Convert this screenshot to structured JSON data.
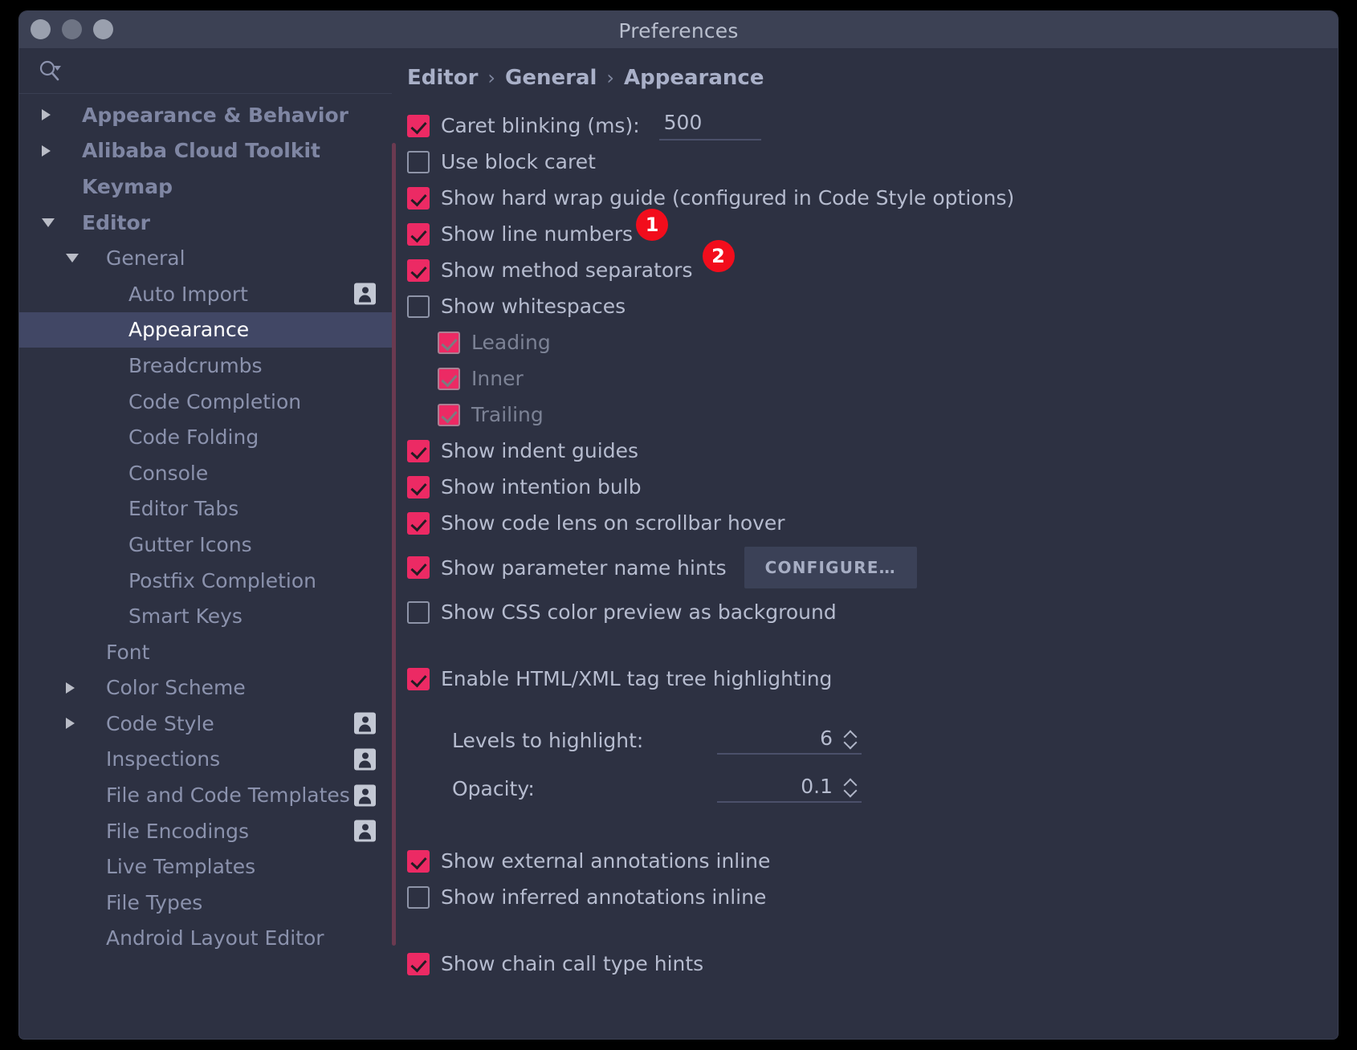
{
  "window": {
    "title": "Preferences",
    "traffic_lights": [
      "close",
      "minimize",
      "maximize"
    ]
  },
  "search": {
    "placeholder": ""
  },
  "sidebar": {
    "items": [
      {
        "label": "Appearance & Behavior",
        "indent": 0,
        "arrow": "right",
        "bold": true,
        "selected": false,
        "user_icon": false
      },
      {
        "label": "Alibaba Cloud Toolkit",
        "indent": 0,
        "arrow": "right",
        "bold": true,
        "selected": false,
        "user_icon": false
      },
      {
        "label": "Keymap",
        "indent": 0,
        "arrow": "none",
        "bold": true,
        "selected": false,
        "user_icon": false
      },
      {
        "label": "Editor",
        "indent": 0,
        "arrow": "down",
        "bold": true,
        "selected": false,
        "user_icon": false
      },
      {
        "label": "General",
        "indent": 1,
        "arrow": "down",
        "bold": false,
        "selected": false,
        "user_icon": false
      },
      {
        "label": "Auto Import",
        "indent": 2,
        "arrow": "none",
        "bold": false,
        "selected": false,
        "user_icon": true
      },
      {
        "label": "Appearance",
        "indent": 2,
        "arrow": "none",
        "bold": false,
        "selected": true,
        "user_icon": false
      },
      {
        "label": "Breadcrumbs",
        "indent": 2,
        "arrow": "none",
        "bold": false,
        "selected": false,
        "user_icon": false
      },
      {
        "label": "Code Completion",
        "indent": 2,
        "arrow": "none",
        "bold": false,
        "selected": false,
        "user_icon": false
      },
      {
        "label": "Code Folding",
        "indent": 2,
        "arrow": "none",
        "bold": false,
        "selected": false,
        "user_icon": false
      },
      {
        "label": "Console",
        "indent": 2,
        "arrow": "none",
        "bold": false,
        "selected": false,
        "user_icon": false
      },
      {
        "label": "Editor Tabs",
        "indent": 2,
        "arrow": "none",
        "bold": false,
        "selected": false,
        "user_icon": false
      },
      {
        "label": "Gutter Icons",
        "indent": 2,
        "arrow": "none",
        "bold": false,
        "selected": false,
        "user_icon": false
      },
      {
        "label": "Postfix Completion",
        "indent": 2,
        "arrow": "none",
        "bold": false,
        "selected": false,
        "user_icon": false
      },
      {
        "label": "Smart Keys",
        "indent": 2,
        "arrow": "none",
        "bold": false,
        "selected": false,
        "user_icon": false
      },
      {
        "label": "Font",
        "indent": 1,
        "arrow": "none",
        "bold": false,
        "selected": false,
        "user_icon": false
      },
      {
        "label": "Color Scheme",
        "indent": 1,
        "arrow": "right",
        "bold": false,
        "selected": false,
        "user_icon": false
      },
      {
        "label": "Code Style",
        "indent": 1,
        "arrow": "right",
        "bold": false,
        "selected": false,
        "user_icon": true
      },
      {
        "label": "Inspections",
        "indent": 1,
        "arrow": "none",
        "bold": false,
        "selected": false,
        "user_icon": true
      },
      {
        "label": "File and Code Templates",
        "indent": 1,
        "arrow": "none",
        "bold": false,
        "selected": false,
        "user_icon": true
      },
      {
        "label": "File Encodings",
        "indent": 1,
        "arrow": "none",
        "bold": false,
        "selected": false,
        "user_icon": true
      },
      {
        "label": "Live Templates",
        "indent": 1,
        "arrow": "none",
        "bold": false,
        "selected": false,
        "user_icon": false
      },
      {
        "label": "File Types",
        "indent": 1,
        "arrow": "none",
        "bold": false,
        "selected": false,
        "user_icon": false
      },
      {
        "label": "Android Layout Editor",
        "indent": 1,
        "arrow": "none",
        "bold": false,
        "selected": false,
        "user_icon": false
      }
    ]
  },
  "breadcrumb": {
    "parts": [
      "Editor",
      "General",
      "Appearance"
    ],
    "separator": "›"
  },
  "options": {
    "caret_blinking": {
      "label": "Caret blinking (ms):",
      "checked": true,
      "value": "500"
    },
    "use_block_caret": {
      "label": "Use block caret",
      "checked": false
    },
    "hard_wrap_guide": {
      "label": "Show hard wrap guide (configured in Code Style options)",
      "checked": true
    },
    "line_numbers": {
      "label": "Show line numbers",
      "checked": true,
      "badge": "1"
    },
    "method_separators": {
      "label": "Show method separators",
      "checked": true,
      "badge": "2",
      "focused": true
    },
    "whitespaces": {
      "label": "Show whitespaces",
      "checked": false
    },
    "whitespace_children": [
      {
        "label": "Leading",
        "checked": true,
        "disabled": true
      },
      {
        "label": "Inner",
        "checked": true,
        "disabled": true
      },
      {
        "label": "Trailing",
        "checked": true,
        "disabled": true
      }
    ],
    "indent_guides": {
      "label": "Show indent guides",
      "checked": true
    },
    "intention_bulb": {
      "label": "Show intention bulb",
      "checked": true
    },
    "code_lens": {
      "label": "Show code lens on scrollbar hover",
      "checked": true
    },
    "parameter_hints": {
      "label": "Show parameter name hints",
      "checked": true,
      "button": "CONFIGURE…"
    },
    "css_color_preview": {
      "label": "Show CSS color preview as background",
      "checked": false
    },
    "tag_tree_highlighting": {
      "label": "Enable HTML/XML tag tree highlighting",
      "checked": true
    },
    "levels_to_highlight": {
      "label": "Levels to highlight:",
      "value": "6"
    },
    "opacity": {
      "label": "Opacity:",
      "value": "0.1"
    },
    "external_annotations": {
      "label": "Show external annotations inline",
      "checked": true
    },
    "inferred_annotations": {
      "label": "Show inferred annotations inline",
      "checked": false
    },
    "chain_call_hints": {
      "label": "Show chain call type hints",
      "checked": true
    }
  },
  "colors": {
    "accent_checkbox": "#ec2a64",
    "badge_red": "#f20d1c",
    "selection": "#414765",
    "panel_bg": "#2d3142",
    "titlebar_bg": "#3c4154",
    "scroll_accent": "#6b3a50"
  }
}
